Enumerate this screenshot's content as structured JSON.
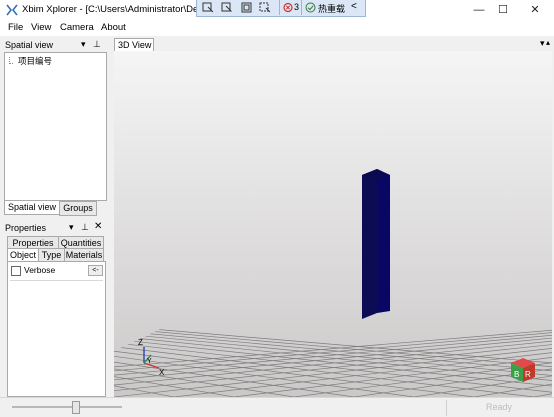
{
  "window": {
    "title": "Xbim Xplorer - [C:\\Users\\Administrator\\De",
    "minimize_icon": "—",
    "maximize_icon": "☐",
    "close_icon": "✕"
  },
  "debug_toolbar": {
    "error_count": "3",
    "hot_reload_label": "热重载",
    "collapse_icon": "<"
  },
  "menu": {
    "file": "File",
    "view": "View",
    "camera": "Camera",
    "about": "About"
  },
  "spatial_panel": {
    "title": "Spatial view",
    "pin_icon": "▾ ᵖ",
    "tree_item": "项目编号",
    "tabs": [
      "Spatial view",
      "Groups"
    ]
  },
  "properties_panel": {
    "title": "Properties",
    "tabs_row1": [
      "Properties",
      "Quantities"
    ],
    "tabs_row2": [
      "Object",
      "Type",
      "Materials"
    ],
    "verbose_label": "Verbose",
    "verbose_btn": "<-"
  },
  "view3d": {
    "tab_label": "3D View",
    "axis_z": "Z",
    "axis_y": "Y",
    "axis_x": "X",
    "cube_b": "B",
    "cube_r": "R"
  },
  "status": {
    "ready": "Ready"
  }
}
